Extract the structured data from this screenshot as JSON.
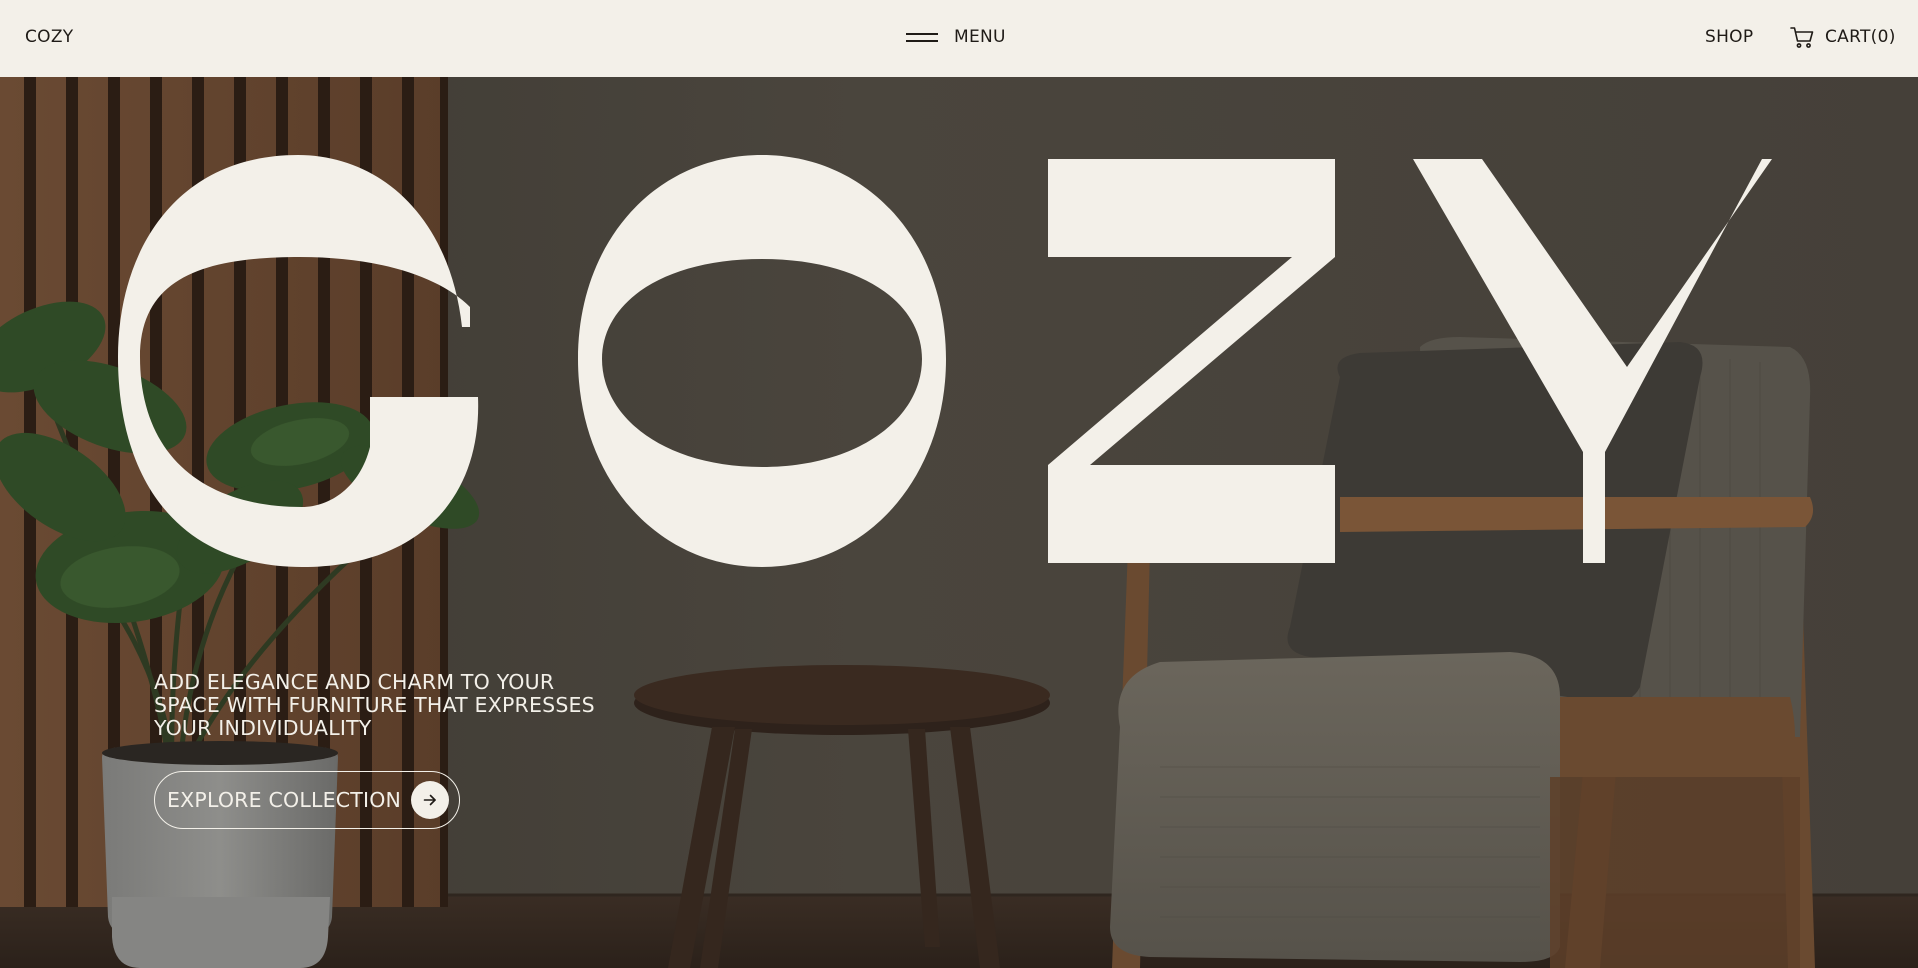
{
  "header": {
    "brand": "COZY",
    "menu_label": "MENU",
    "shop_label": "SHOP",
    "cart_label": "CART(0)"
  },
  "hero": {
    "big_word": "COZY",
    "tagline": "ADD ELEGANCE AND CHARM TO YOUR SPACE WITH FURNITURE THAT EXPRESSES YOUR INDIVIDUALITY",
    "cta_label": "EXPLORE COLLECTION"
  },
  "icons": {
    "menu": "hamburger-icon",
    "cart": "shopping-cart-icon",
    "cta": "arrow-right-icon"
  },
  "colors": {
    "cream": "#f3f0e9",
    "ink": "#1f1b17",
    "wall": "#4a453e"
  }
}
